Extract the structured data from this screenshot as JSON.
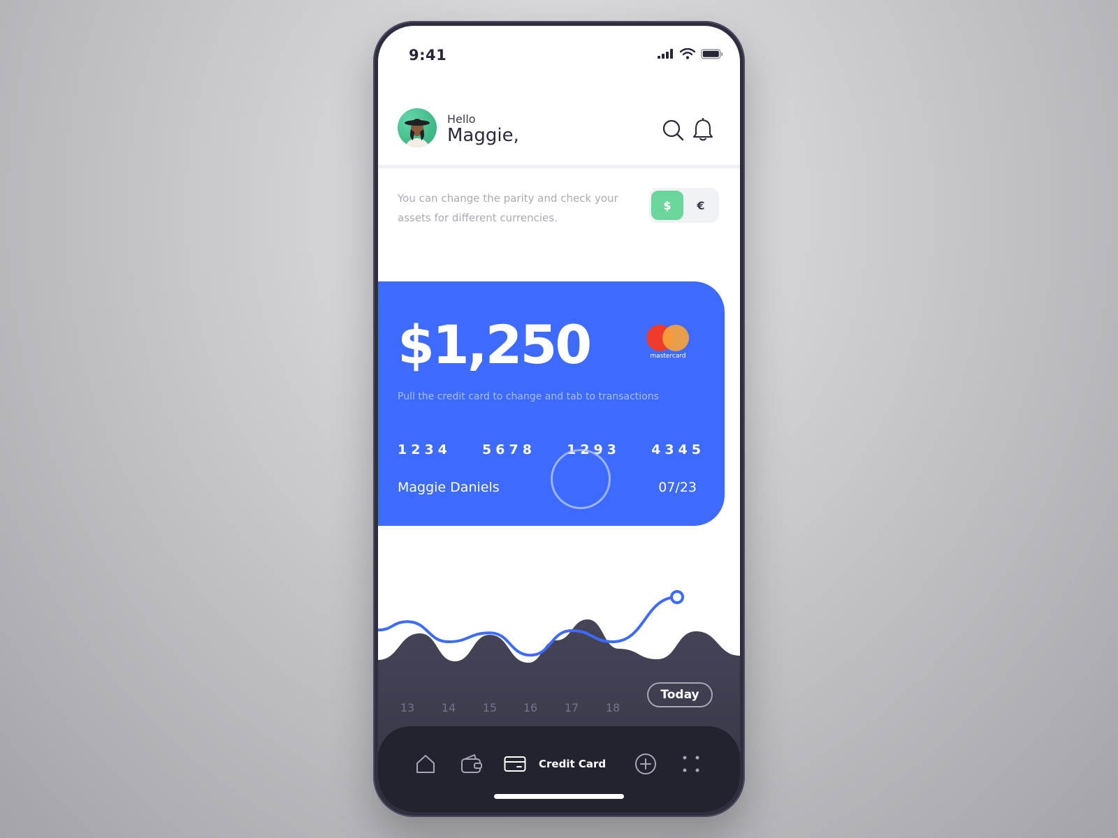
{
  "status_bar": {
    "time": "9:41"
  },
  "header": {
    "greeting": "Hello",
    "user_name": "Maggie,"
  },
  "currency": {
    "info": "You can change the parity and check your assets for different currencies.",
    "options": [
      "$",
      "€"
    ],
    "selected": "$"
  },
  "card": {
    "balance": "$1,250",
    "brand": "mastercard",
    "hint": "Pull the credit card to change and tab to transactions",
    "number_groups": [
      "1234",
      "5678",
      "1293",
      "4345"
    ],
    "holder": "Maggie Daniels",
    "expiry": "07/23"
  },
  "chart_data": {
    "type": "line",
    "x": [
      "13",
      "14",
      "15",
      "16",
      "17",
      "18",
      "Today"
    ],
    "series": [
      {
        "values": [
          48,
          30,
          38,
          18,
          40,
          30,
          70
        ]
      }
    ],
    "ylim": [
      0,
      100
    ],
    "selected": "Today"
  },
  "tab_bar": {
    "active_label": "Credit Card",
    "items": [
      "home",
      "wallet",
      "credit-card",
      "add",
      "more"
    ]
  },
  "colors": {
    "card": "#3d6aff",
    "accent_green": "#6ad69c",
    "dark": "#23222f",
    "line": "#3d6aff"
  }
}
